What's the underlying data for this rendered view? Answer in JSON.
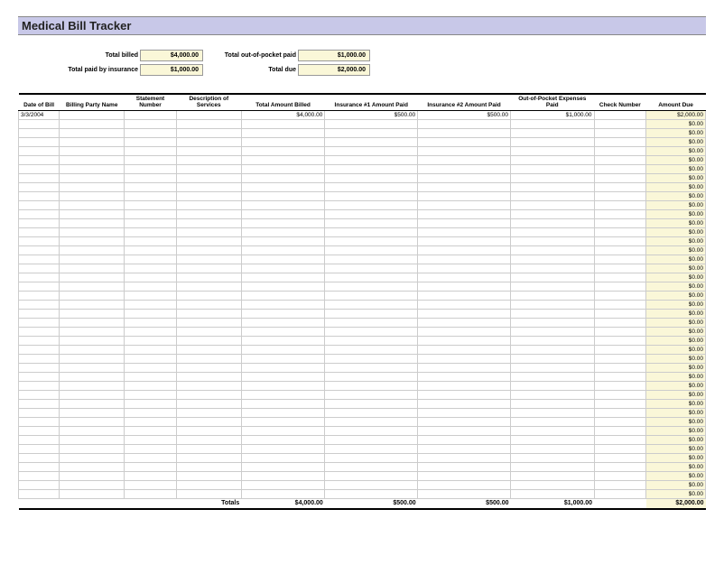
{
  "title": "Medical Bill Tracker",
  "summary": {
    "total_billed_label": "Total billed",
    "total_billed": "$4,000.00",
    "total_oop_label": "Total out-of-pocket paid",
    "total_oop": "$1,000.00",
    "total_ins_label": "Total paid by insurance",
    "total_ins": "$1,000.00",
    "total_due_label": "Total due",
    "total_due": "$2,000.00"
  },
  "columns": {
    "date": "Date of Bill",
    "party": "Billing Party Name",
    "stmt": "Statement Number",
    "desc": "Description of Services",
    "total": "Total Amount Billed",
    "ins1": "Insurance #1 Amount Paid",
    "ins2": "Insurance #2 Amount Paid",
    "oop": "Out-of-Pocket Expenses Paid",
    "check": "Check Number",
    "due": "Amount Due"
  },
  "rows": [
    {
      "date": "3/3/2004",
      "party": "",
      "stmt": "",
      "desc": "",
      "total": "$4,000.00",
      "ins1": "$500.00",
      "ins2": "$500.00",
      "oop": "$1,000.00",
      "check": "",
      "due": "$2,000.00"
    },
    {
      "due": "$0.00"
    },
    {
      "due": "$0.00"
    },
    {
      "due": "$0.00"
    },
    {
      "due": "$0.00"
    },
    {
      "due": "$0.00"
    },
    {
      "due": "$0.00"
    },
    {
      "due": "$0.00"
    },
    {
      "due": "$0.00"
    },
    {
      "due": "$0.00"
    },
    {
      "due": "$0.00"
    },
    {
      "due": "$0.00"
    },
    {
      "due": "$0.00"
    },
    {
      "due": "$0.00"
    },
    {
      "due": "$0.00"
    },
    {
      "due": "$0.00"
    },
    {
      "due": "$0.00"
    },
    {
      "due": "$0.00"
    },
    {
      "due": "$0.00"
    },
    {
      "due": "$0.00"
    },
    {
      "due": "$0.00"
    },
    {
      "due": "$0.00"
    },
    {
      "due": "$0.00"
    },
    {
      "due": "$0.00"
    },
    {
      "due": "$0.00"
    },
    {
      "due": "$0.00"
    },
    {
      "due": "$0.00"
    },
    {
      "due": "$0.00"
    },
    {
      "due": "$0.00"
    },
    {
      "due": "$0.00"
    },
    {
      "due": "$0.00"
    },
    {
      "due": "$0.00"
    },
    {
      "due": "$0.00"
    },
    {
      "due": "$0.00"
    },
    {
      "due": "$0.00"
    },
    {
      "due": "$0.00"
    },
    {
      "due": "$0.00"
    },
    {
      "due": "$0.00"
    },
    {
      "due": "$0.00"
    },
    {
      "due": "$0.00"
    },
    {
      "due": "$0.00"
    },
    {
      "due": "$0.00"
    },
    {
      "due": "$0.00"
    }
  ],
  "totals": {
    "label": "Totals",
    "total": "$4,000.00",
    "ins1": "$500.00",
    "ins2": "$500.00",
    "oop": "$1,000.00",
    "due": "$2,000.00"
  }
}
